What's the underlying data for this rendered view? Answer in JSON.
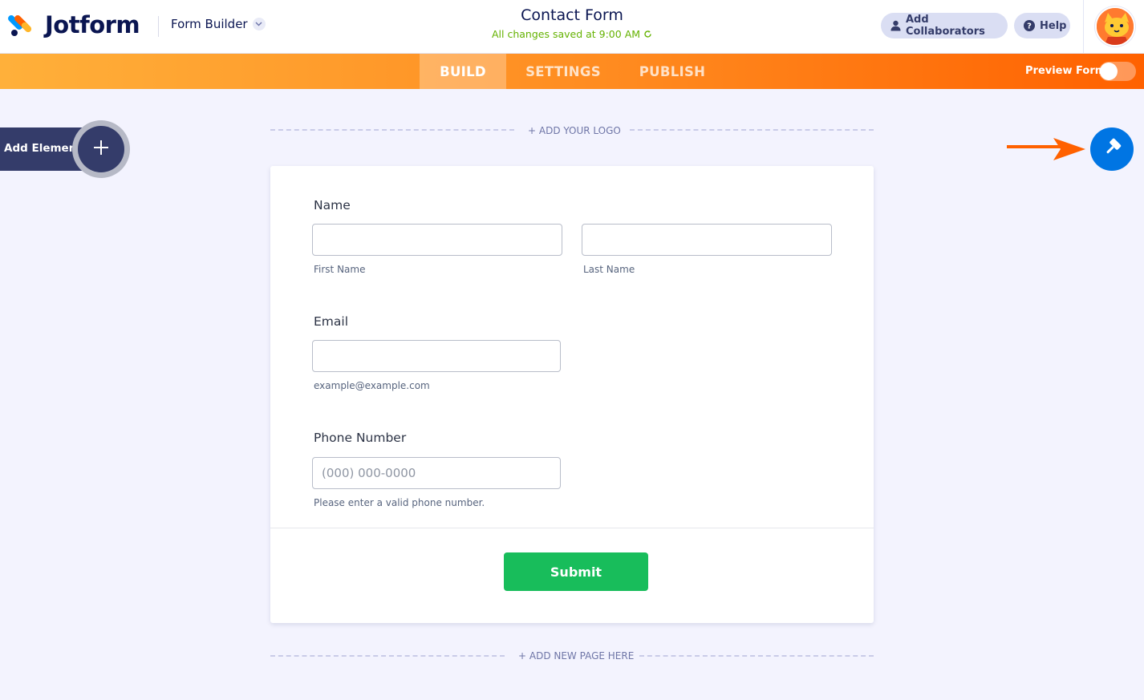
{
  "header": {
    "brand": "Jotform",
    "builder_switch": "Form Builder",
    "form_title": "Contact Form",
    "save_status": "All changes saved at 9:00 AM",
    "add_collaborators": "Add Collaborators",
    "help": "Help"
  },
  "nav": {
    "tabs": [
      {
        "label": "BUILD",
        "active": true
      },
      {
        "label": "SETTINGS",
        "active": false
      },
      {
        "label": "PUBLISH",
        "active": false
      }
    ],
    "preview_label": "Preview Form",
    "preview_on": false
  },
  "sidebar": {
    "add_element": "Add Element"
  },
  "canvas": {
    "add_logo": "+ ADD YOUR LOGO",
    "add_page": "+ ADD NEW PAGE HERE"
  },
  "form": {
    "name": {
      "label": "Name",
      "first_sublabel": "First Name",
      "last_sublabel": "Last Name",
      "first_value": "",
      "last_value": ""
    },
    "email": {
      "label": "Email",
      "sublabel": "example@example.com",
      "value": ""
    },
    "phone": {
      "label": "Phone Number",
      "placeholder": "(000) 000-0000",
      "sublabel": "Please enter a valid phone number.",
      "value": ""
    },
    "submit_label": "Submit"
  },
  "colors": {
    "brand_navy": "#0a1551",
    "nav_orange_start": "#ffb03a",
    "nav_orange_end": "#ff6100",
    "save_green": "#64b200",
    "submit_green": "#18bd5b",
    "designer_blue": "#0075e3",
    "arrow_orange": "#ff6100"
  },
  "icons": {
    "brand": "jotform-logo-icon",
    "builder_chevron": "chevron-down-icon",
    "refresh": "refresh-icon",
    "collaborators": "user-icon",
    "help": "question-circle-icon",
    "avatar": "cat-avatar-icon",
    "add": "plus-icon",
    "designer": "paint-roller-icon",
    "pointer": "arrow-right-icon"
  }
}
